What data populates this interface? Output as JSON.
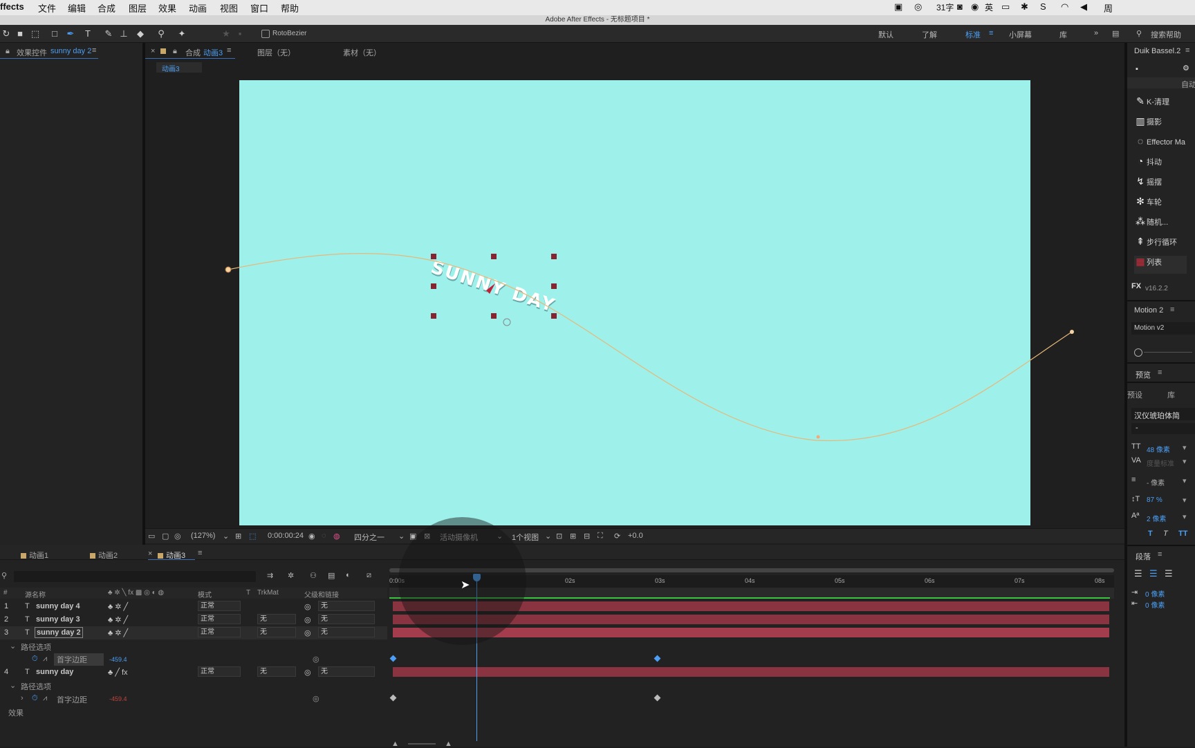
{
  "menubar": {
    "app": "ffects",
    "items": [
      "文件",
      "编辑",
      "合成",
      "图层",
      "效果",
      "动画",
      "视图",
      "窗口",
      "帮助"
    ],
    "status_words": "31字",
    "status_lang": "英",
    "status_day": "周"
  },
  "titlebar": {
    "title": "Adobe After Effects - 无标题项目 *"
  },
  "toolbar": {
    "rotobezier": "RotoBezier",
    "workspaces": [
      "默认",
      "了解",
      "标准",
      "小屏幕",
      "库"
    ],
    "active_workspace": "标准",
    "search_help": "搜索帮助"
  },
  "effects_panel": {
    "tab_prefix": "效果控件",
    "tab_layer": "sunny day 2"
  },
  "comp_panel": {
    "tab_prefix": "合成",
    "tab_comp": "动画3",
    "layer_tab": "图层（无）",
    "footage_tab": "素材（无）",
    "breadcrumb": "动画3",
    "canvas_text": "SUNNY DAY",
    "bg_color": "#9ef0ea"
  },
  "comp_controls": {
    "zoom": "(127%)",
    "timecode": "0:00:00:24",
    "resolution": "四分之一",
    "camera": "活动摄像机",
    "views": "1个视图",
    "exposure": "+0.0"
  },
  "timeline": {
    "tabs": [
      "动画1",
      "动画2",
      "动画3"
    ],
    "active_tab": "动画3",
    "headers": {
      "num": "#",
      "source": "源名称",
      "mode": "模式",
      "t": "T",
      "trkmat": "TrkMat",
      "parent": "父级和链接"
    },
    "ruler": [
      "0:00s",
      "",
      "02s",
      "03s",
      "04s",
      "05s",
      "06s",
      "07s",
      "08s"
    ],
    "layers": [
      {
        "num": "1",
        "name": "sunny day 4",
        "mode": "正常",
        "trkmat": "",
        "parent": "无"
      },
      {
        "num": "2",
        "name": "sunny day 3",
        "mode": "正常",
        "trkmat": "无",
        "parent": "无"
      },
      {
        "num": "3",
        "name": "sunny day 2",
        "mode": "正常",
        "trkmat": "无",
        "parent": "无"
      },
      {
        "num": "4",
        "name": "sunny day",
        "mode": "正常",
        "trkmat": "无",
        "parent": "无"
      }
    ],
    "path_options": "路径选项",
    "first_margin": "首字边距",
    "value_blue": "-459.4",
    "value_red": "-459.4",
    "effects": "效果",
    "playhead_time": 0.97,
    "duration": 8
  },
  "right_panel": {
    "duik_tab": "Duik Bassel.2",
    "auto": "自动",
    "tools": [
      "K-清理",
      "摄影",
      "Effector Ma",
      "抖动",
      "摇摆",
      "车轮",
      "随机...",
      "步行循环",
      "列表"
    ],
    "fx_version": "v16.2.2",
    "motion_tab": "Motion 2",
    "motion_version": "Motion v2",
    "preview_tab": "预览",
    "preset": "预设",
    "library": "库",
    "font": "汉仪琥珀体简",
    "font_style": "-",
    "font_size": "48 像素",
    "tracking": "度量标准",
    "leading": "- 像素",
    "vscale": "87 %",
    "baseline": "2 像素",
    "paragraph_tab": "段落",
    "indent1": "0 像素",
    "indent2": "0 像素"
  }
}
